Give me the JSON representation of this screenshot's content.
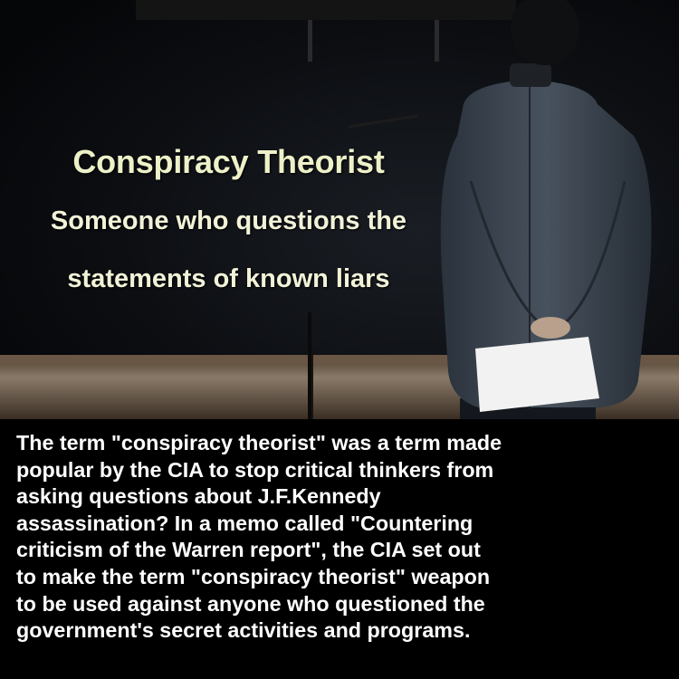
{
  "headline": {
    "title": "Conspiracy Theorist",
    "line1": "Someone who questions the",
    "line2": "statements of known liars"
  },
  "caption": {
    "lines": [
      "The term \"conspiracy theorist\" was a term made",
      "popular by the CIA to stop critical thinkers from",
      "asking questions about J.F.Kennedy",
      "assassination? In a memo called \"Countering",
      "criticism of the Warren report\", the CIA set out",
      "to make the term \"conspiracy theorist\" weapon",
      "to be used against anyone who questioned the",
      "government's secret activities and programs."
    ]
  },
  "colors": {
    "headline_text": "#f2f2d8",
    "caption_text": "#ffffff",
    "caption_background": "#000000",
    "suit": "#3a4450"
  }
}
